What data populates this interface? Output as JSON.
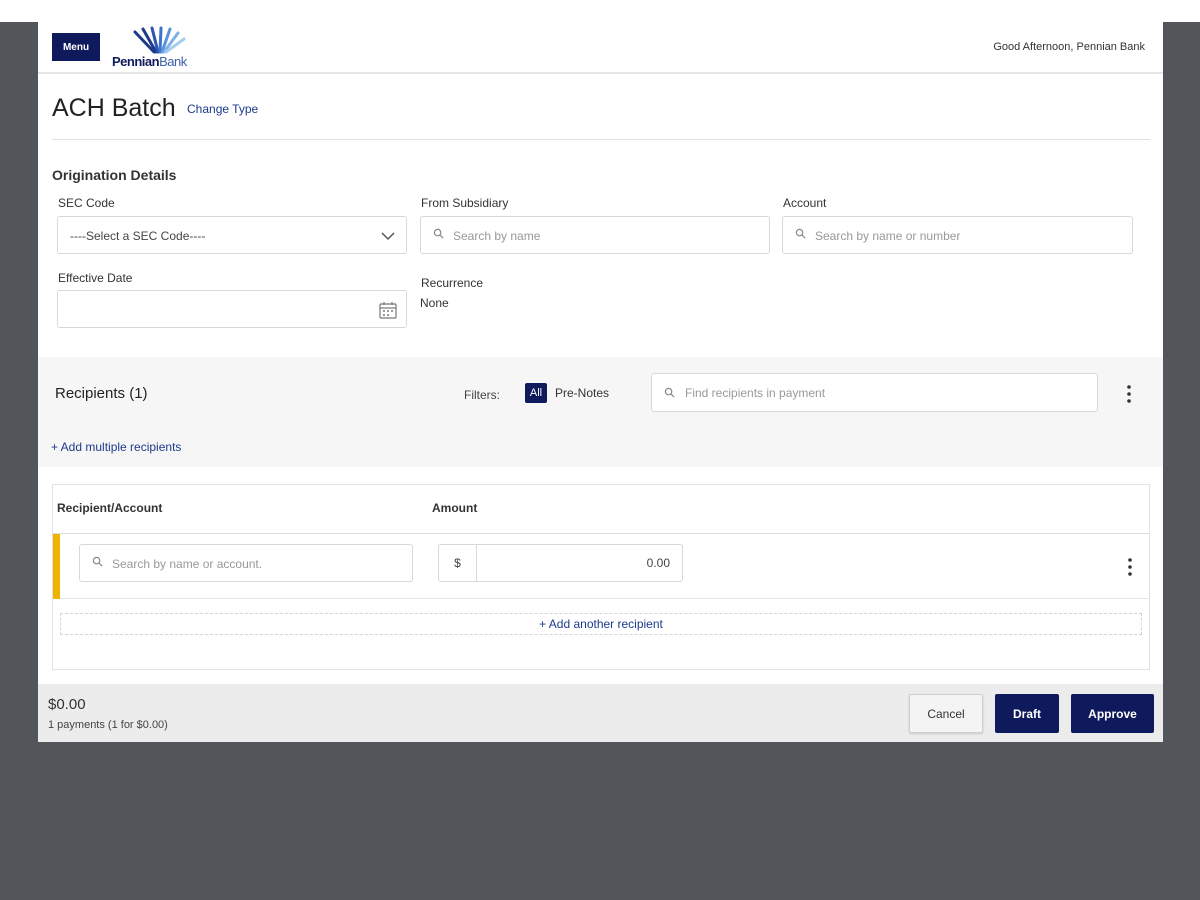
{
  "header": {
    "menu_label": "Menu",
    "logo_bold": "Pennian",
    "logo_thin": "Bank",
    "greeting": "Good Afternoon, Pennian Bank"
  },
  "page": {
    "title": "ACH Batch",
    "change_type": "Change Type"
  },
  "origination": {
    "section_title": "Origination Details",
    "sec_code": {
      "label": "SEC Code",
      "value": "----Select a SEC Code----"
    },
    "from_subsidiary": {
      "label": "From Subsidiary",
      "placeholder": "Search by name"
    },
    "account": {
      "label": "Account",
      "placeholder": "Search by name or number"
    },
    "effective_date": {
      "label": "Effective Date",
      "value": ""
    },
    "recurrence": {
      "label": "Recurrence",
      "value": "None"
    }
  },
  "recipients": {
    "title": "Recipients (1)",
    "filters_label": "Filters:",
    "filter_all": "All",
    "filter_prenotes": "Pre-Notes",
    "find_placeholder": "Find recipients in payment",
    "add_multiple": "+ Add multiple recipients"
  },
  "table": {
    "col_recipient": "Recipient/Account",
    "col_amount": "Amount",
    "rows": [
      {
        "recipient_placeholder": "Search by name or account.",
        "currency": "$",
        "amount": "0.00"
      }
    ],
    "add_another": "+ Add another recipient"
  },
  "footer": {
    "total": "$0.00",
    "summary": "1 payments (1 for $0.00)",
    "cancel": "Cancel",
    "draft": "Draft",
    "approve": "Approve"
  },
  "colors": {
    "brand_navy": "#0f1a5c",
    "link_blue": "#1d3a8a",
    "row_accent": "#f0b400",
    "backdrop": "#52565b"
  },
  "icons": [
    "search-icon",
    "chevron-down-icon",
    "calendar-icon",
    "kebab-menu-icon",
    "logo-fan-icon"
  ]
}
